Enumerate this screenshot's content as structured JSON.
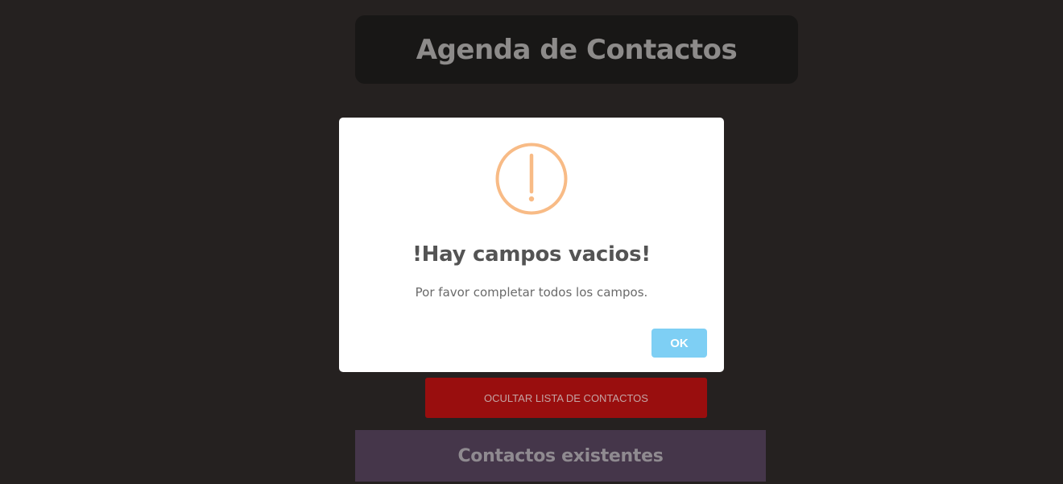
{
  "header": {
    "title": "Agenda de Contactos"
  },
  "dialog": {
    "icon": "warning-icon",
    "title": "!Hay campos vacios!",
    "message": "Por favor completar todos los campos.",
    "ok_label": "OK"
  },
  "actions": {
    "toggle_list_label": "OCULTAR LISTA DE CONTACTOS"
  },
  "contacts": {
    "heading": "Contactos existentes"
  },
  "colors": {
    "background": "#252120",
    "header_bg": "#181716",
    "warning": "#f8bb86",
    "ok_button": "#7ecff4",
    "toggle_button": "#990e0e",
    "contacts_header_bg": "#45364a"
  }
}
